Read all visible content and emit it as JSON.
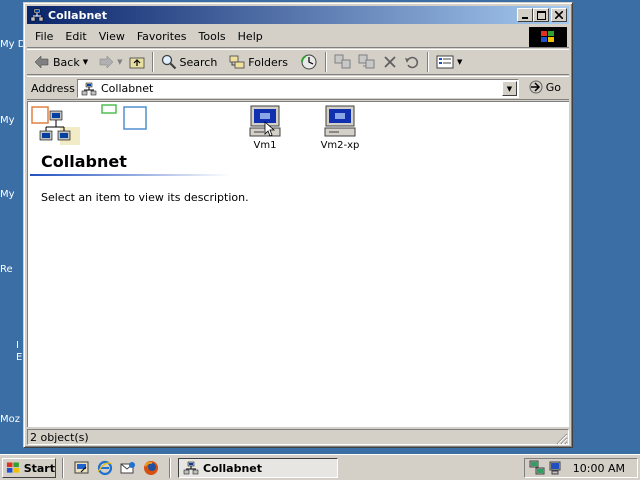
{
  "desktop": {
    "labels": [
      {
        "text": "My D"
      },
      {
        "text": "My"
      },
      {
        "text": "My"
      },
      {
        "text": "Re"
      },
      {
        "text": "I"
      },
      {
        "text": "E"
      },
      {
        "text": "Moz"
      }
    ]
  },
  "window": {
    "title": "Collabnet",
    "menu": [
      "File",
      "Edit",
      "View",
      "Favorites",
      "Tools",
      "Help"
    ],
    "toolbar": {
      "back": "Back",
      "search": "Search",
      "folders": "Folders"
    },
    "address": {
      "label": "Address",
      "value": "Collabnet",
      "go": "Go"
    },
    "content": {
      "folder_title": "Collabnet",
      "description": "Select an item to view its description.",
      "items": [
        {
          "name": "Vm1",
          "icon": "computer-icon"
        },
        {
          "name": "Vm2-xp",
          "icon": "computer-icon"
        }
      ]
    },
    "status": "2 object(s)"
  },
  "taskbar": {
    "start": "Start",
    "task": "Collabnet",
    "clock": "10:00 AM"
  },
  "colors": {
    "desktop": "#3a6ea5",
    "titlebar_start": "#0a246a",
    "titlebar_end": "#a6caf0",
    "chrome": "#d4d0c8"
  }
}
